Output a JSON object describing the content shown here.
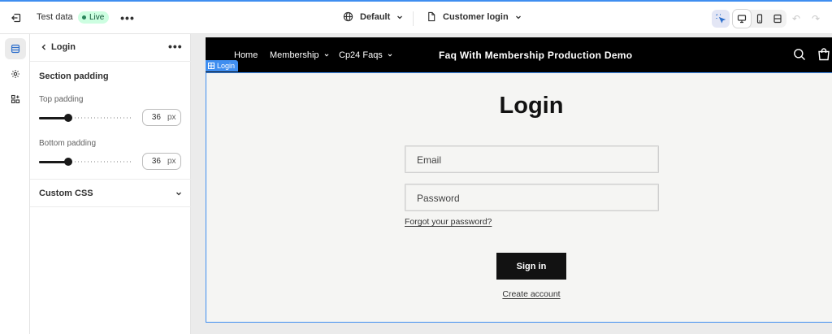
{
  "topbar": {
    "test_data_label": "Test data",
    "live_badge": "Live",
    "theme_selector": "Default",
    "template_selector": "Customer login",
    "accent_color": "#3f8ef0"
  },
  "rail": {
    "items": [
      "sections-icon",
      "theme-settings-icon",
      "apps-icon"
    ]
  },
  "panel": {
    "title": "Login",
    "section_heading": "Section padding",
    "top_padding": {
      "label": "Top padding",
      "value": "36",
      "unit": "px",
      "fraction": 0.31
    },
    "bottom_padding": {
      "label": "Bottom padding",
      "value": "36",
      "unit": "px",
      "fraction": 0.31
    },
    "custom_css_label": "Custom CSS"
  },
  "preview": {
    "nav": [
      "Home",
      "Membership",
      "Cp24 Faqs"
    ],
    "store_name": "Faq With Membership Production Demo",
    "section_tag": "Login",
    "login_title": "Login",
    "email_placeholder": "Email",
    "password_placeholder": "Password",
    "forgot_link": "Forgot your password?",
    "signin_button": "Sign in",
    "create_account_link": "Create account"
  }
}
